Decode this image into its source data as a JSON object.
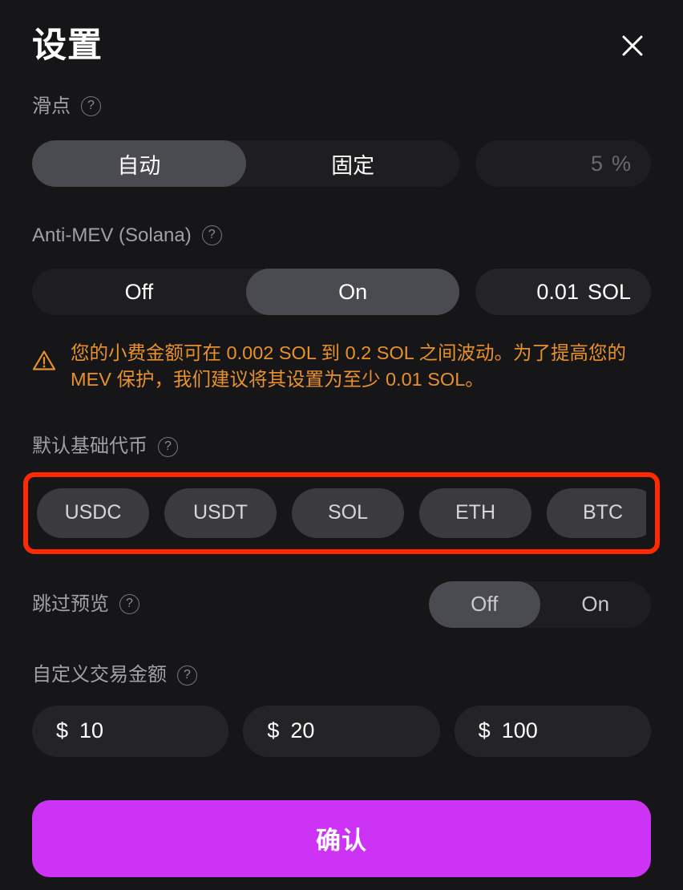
{
  "header": {
    "title": "设置",
    "close_label": "close-icon"
  },
  "slippage": {
    "label": "滑点",
    "help": "?",
    "options": [
      {
        "label": "自动",
        "selected": true
      },
      {
        "label": "固定",
        "selected": false
      }
    ],
    "value": "5",
    "unit": "%",
    "value_is_placeholder": true
  },
  "anti_mev": {
    "label": "Anti-MEV (Solana)",
    "help": "?",
    "options": [
      {
        "label": "Off",
        "selected": false
      },
      {
        "label": "On",
        "selected": true
      }
    ],
    "value": "0.01",
    "unit": "SOL",
    "warning": "您的小费金额可在 0.002 SOL 到 0.2 SOL 之间波动。为了提高您的 MEV 保护，我们建议将其设置为至少 0.01 SOL。",
    "warning_icon": "warning-triangle-icon",
    "warning_color": "#e8912c"
  },
  "default_base_token": {
    "label": "默认基础代币",
    "help": "?",
    "tokens": [
      {
        "symbol": "USDC"
      },
      {
        "symbol": "USDT"
      },
      {
        "symbol": "SOL"
      },
      {
        "symbol": "ETH"
      },
      {
        "symbol": "BTC"
      }
    ],
    "highlight_color": "#ff2a00"
  },
  "skip_preview": {
    "label": "跳过预览",
    "help": "?",
    "options": [
      {
        "label": "Off",
        "selected": true
      },
      {
        "label": "On",
        "selected": false
      }
    ]
  },
  "custom_amounts": {
    "label": "自定义交易金额",
    "help": "?",
    "currency": "$",
    "values": [
      "10",
      "20",
      "100"
    ]
  },
  "confirm": {
    "label": "确认",
    "color": "#cc33f5"
  }
}
